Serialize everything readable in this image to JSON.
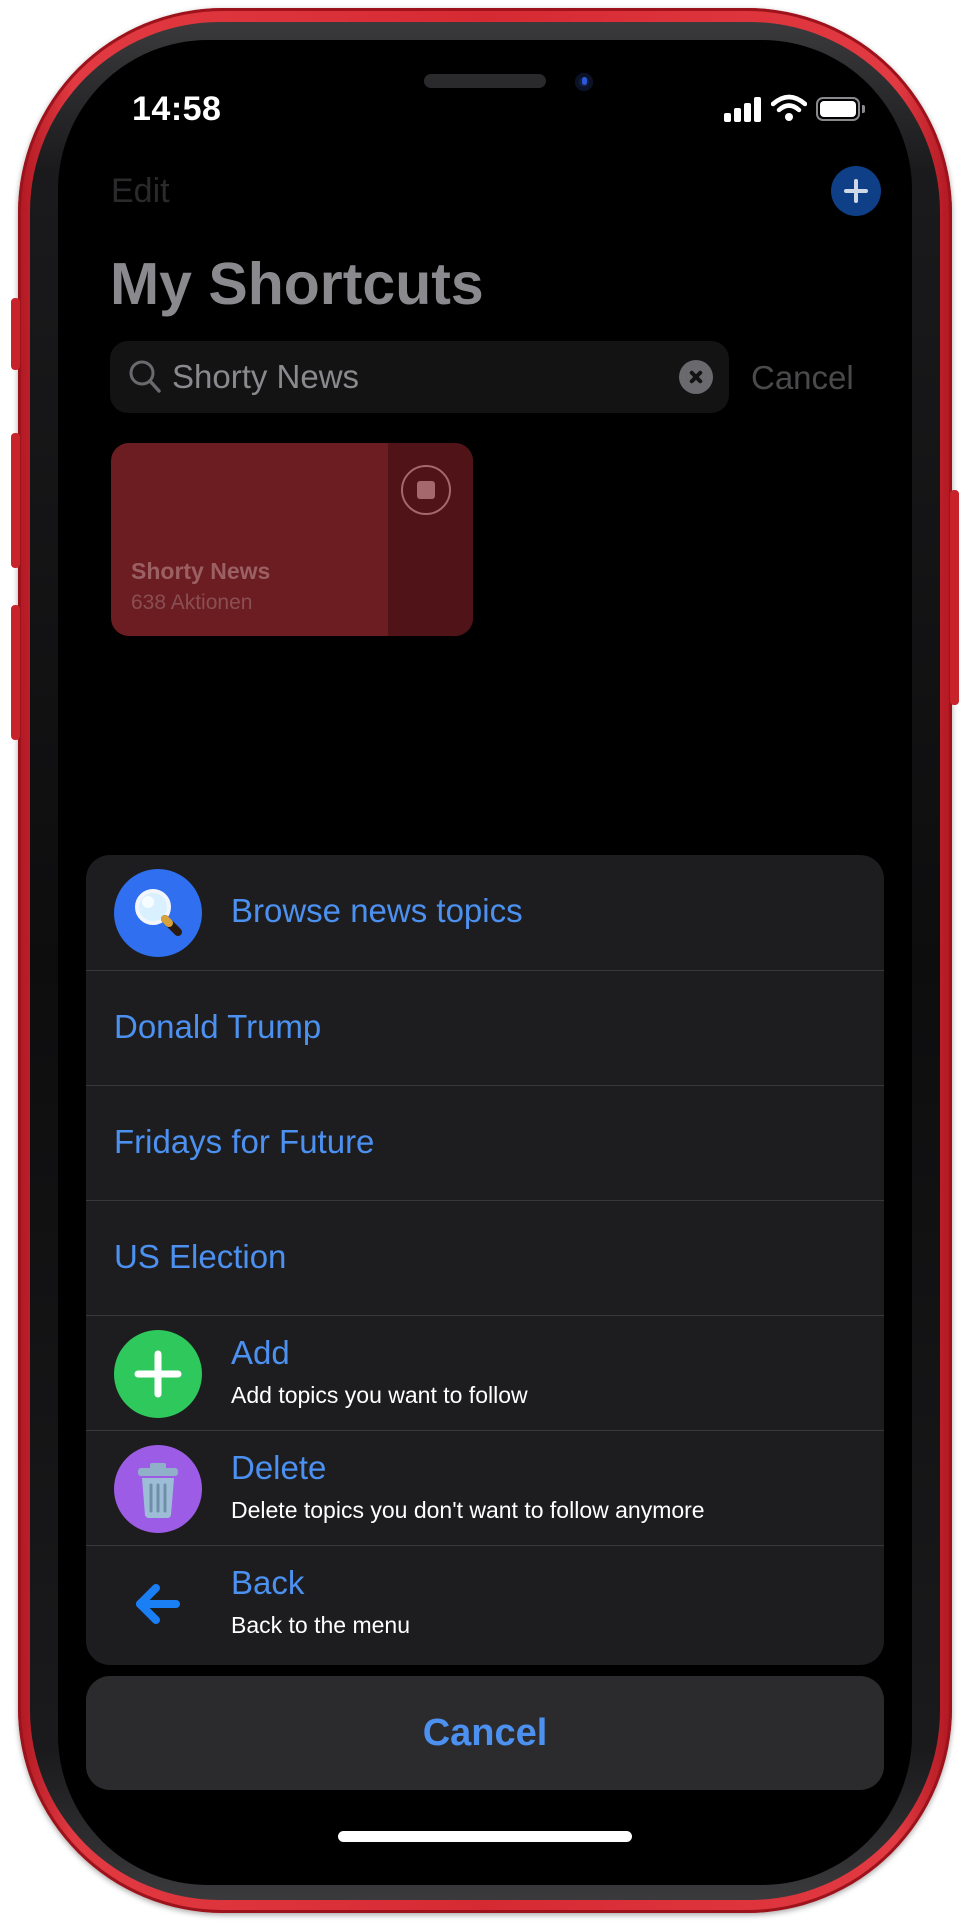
{
  "status_bar": {
    "time": "14:58"
  },
  "nav": {
    "edit_label": "Edit",
    "add_icon": "plus-icon"
  },
  "page": {
    "title": "My Shortcuts"
  },
  "search": {
    "query": "Shorty News",
    "cancel_label": "Cancel"
  },
  "shortcut_tile": {
    "name": "Shorty News",
    "actions": "638 Aktionen",
    "color": "#6c1d22"
  },
  "sheet": {
    "items": [
      {
        "label": "Browse news topics",
        "icon": "magnifier-icon"
      },
      {
        "label": "Donald Trump"
      },
      {
        "label": "Fridays for Future"
      },
      {
        "label": "US Election"
      },
      {
        "label": "Add",
        "subtitle": "Add topics you want to follow",
        "icon": "plus-icon",
        "icon_color": "#2fc85c"
      },
      {
        "label": "Delete",
        "subtitle": "Delete topics you don't want to follow anymore",
        "icon": "trash-icon",
        "icon_color": "#9d5ce6"
      },
      {
        "label": "Back",
        "subtitle": "Back to the menu",
        "icon": "arrow-left-icon",
        "icon_color": "#1a7ef5"
      }
    ],
    "cancel_label": "Cancel"
  },
  "colors": {
    "accent": "#4c90f0",
    "phone_frame": "#d62a33"
  }
}
